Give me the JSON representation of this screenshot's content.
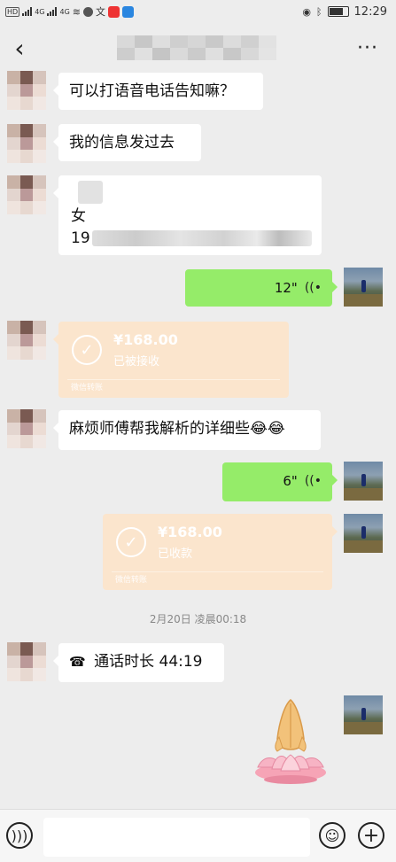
{
  "status_bar": {
    "left_labels": [
      "HD",
      "4G",
      "4G"
    ],
    "time": "12:29",
    "icons": [
      "eye-icon",
      "bluetooth-icon",
      "battery-icon"
    ]
  },
  "header": {
    "back_icon": "‹",
    "more_icon": "···"
  },
  "messages": {
    "m1_text": "可以打语音电话告知嘛？",
    "m2_text": "我的信息发过去",
    "m3_line1": "女",
    "m3_line2": "19",
    "voice1_duration": "12\"",
    "transfer1_amount": "¥168.00",
    "transfer1_status": "已被接收",
    "transfer1_footer": "微信转账",
    "m4_text": "麻烦师傅帮我解析的详细些😂😂",
    "voice2_duration": "6\"",
    "transfer2_amount": "¥168.00",
    "transfer2_status": "已收款",
    "transfer2_footer": "微信转账",
    "timestamp": "2月20日 凌晨00:18",
    "call_text": "通话时长 44:19",
    "sticker": "lotus-pray-sticker"
  },
  "bottom_bar": {
    "voice_icon": "voice-input-icon",
    "emoji_icon": "emoji-icon",
    "plus_icon": "plus-icon"
  },
  "colors": {
    "background": "#ededed",
    "outgoing_bubble": "#95ec69",
    "incoming_bubble": "#ffffff",
    "transfer_card": "#fbe5cd"
  }
}
